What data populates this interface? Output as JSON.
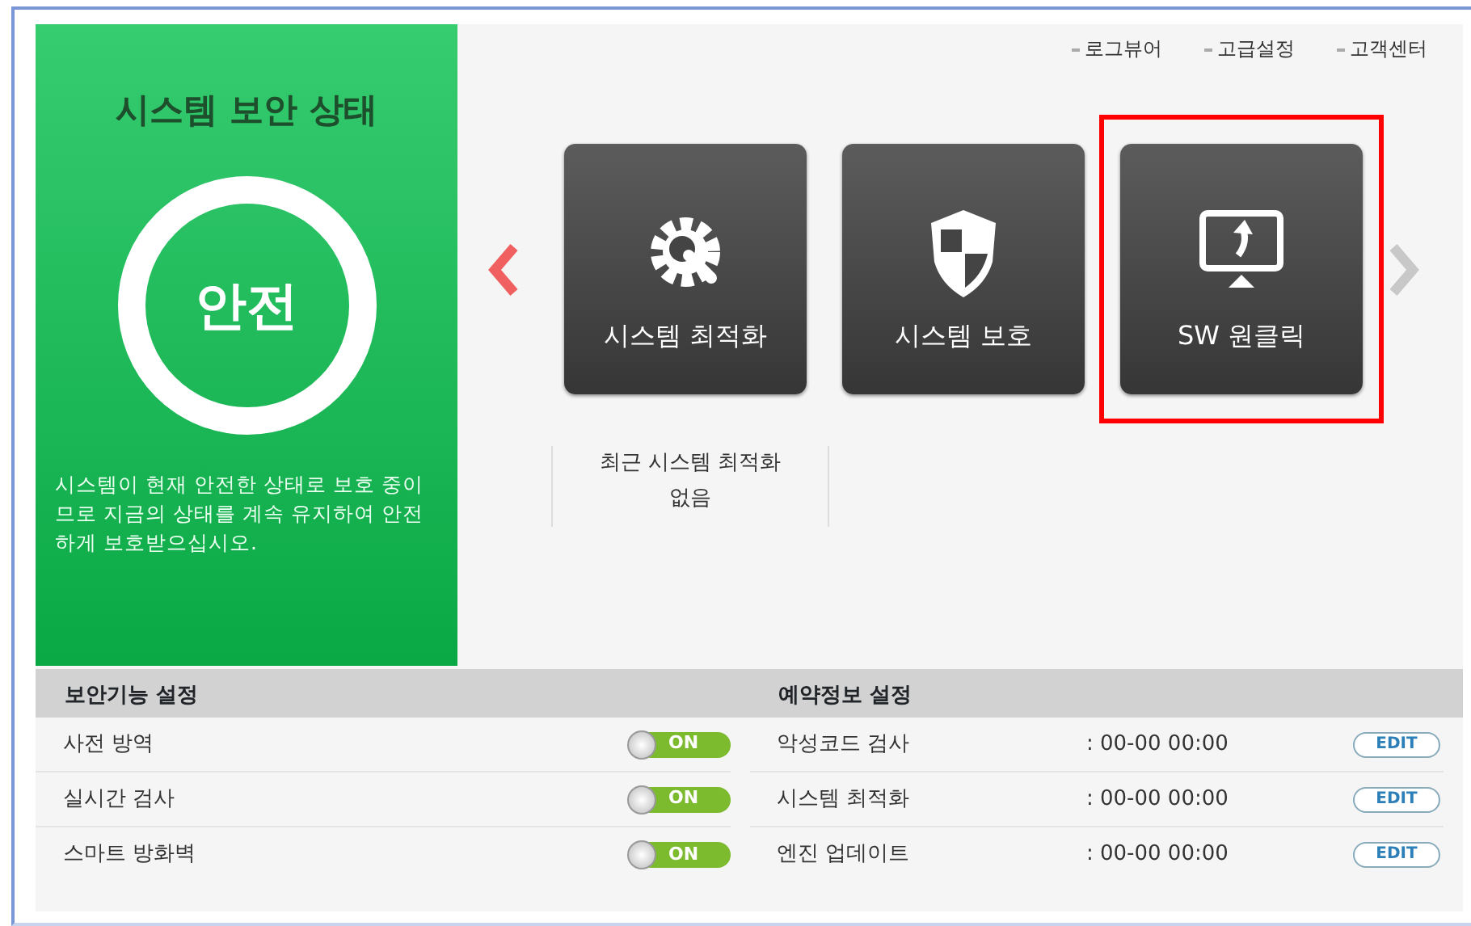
{
  "status_panel": {
    "title": "시스템 보안 상태",
    "state": "안전",
    "message": "시스템이 현재 안전한 상태로 보호 중이므로 지금의 상태를 계속 유지하여 안전하게 보호받으십시오."
  },
  "top_links": [
    "로그뷰어",
    "고급설정",
    "고객센터"
  ],
  "carousel": {
    "tiles": [
      {
        "label": "시스템 최적화",
        "kind": "optimize",
        "highlighted": false
      },
      {
        "label": "시스템 보호",
        "kind": "protect",
        "highlighted": false
      },
      {
        "label": "SW 원클릭",
        "kind": "oneclick",
        "highlighted": true
      }
    ],
    "recent": [
      "최근 시스템 최적화",
      "없음"
    ]
  },
  "security_settings": {
    "title": "보안기능 설정",
    "items": [
      {
        "label": "사전 방역",
        "on": true,
        "toggle_text": "ON"
      },
      {
        "label": "실시간 검사",
        "on": true,
        "toggle_text": "ON"
      },
      {
        "label": "스마트 방화벽",
        "on": true,
        "toggle_text": "ON"
      }
    ]
  },
  "schedule_settings": {
    "title": "예약정보 설정",
    "items": [
      {
        "label": "악성코드 검사",
        "time": ": 00-00 00:00",
        "button": "EDIT"
      },
      {
        "label": "시스템 최적화",
        "time": ": 00-00 00:00",
        "button": "EDIT"
      },
      {
        "label": "엔진 업데이트",
        "time": ": 00-00 00:00",
        "button": "EDIT"
      }
    ]
  }
}
